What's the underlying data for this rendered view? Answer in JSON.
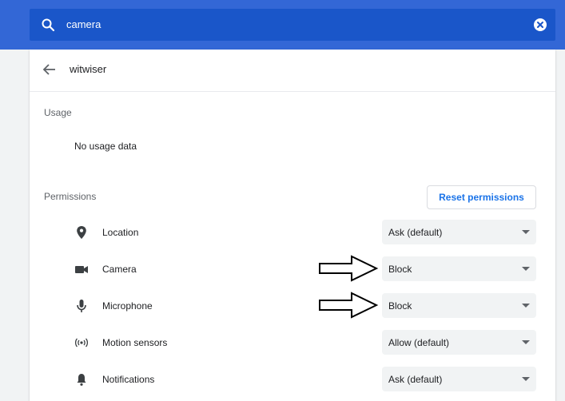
{
  "search": {
    "query": "camera",
    "icon": "search-icon",
    "clear_icon": "clear-icon"
  },
  "site": {
    "back_icon": "arrow-back-icon",
    "name": "witwiser"
  },
  "usage": {
    "heading": "Usage",
    "text": "No usage data"
  },
  "permissions": {
    "heading": "Permissions",
    "reset_label": "Reset permissions",
    "items": [
      {
        "icon": "location-icon",
        "label": "Location",
        "value": "Ask (default)"
      },
      {
        "icon": "camera-icon",
        "label": "Camera",
        "value": "Block"
      },
      {
        "icon": "microphone-icon",
        "label": "Microphone",
        "value": "Block"
      },
      {
        "icon": "motion-sensors-icon",
        "label": "Motion sensors",
        "value": "Allow (default)"
      },
      {
        "icon": "notifications-icon",
        "label": "Notifications",
        "value": "Ask (default)"
      }
    ]
  },
  "colors": {
    "header": "#3367d6",
    "search_bg": "#1a56c9",
    "accent": "#1a73e8",
    "page_bg": "#f1f3f4"
  },
  "annotations": [
    "arrow-pointing-right",
    "arrow-pointing-right"
  ]
}
